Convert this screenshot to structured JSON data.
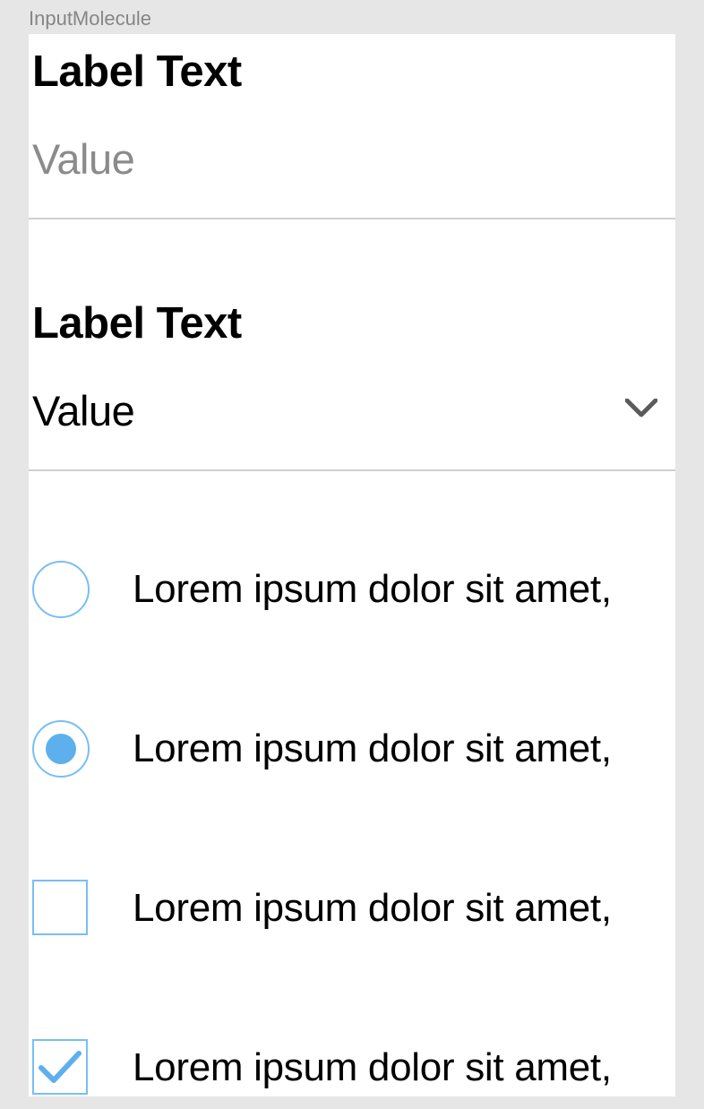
{
  "componentTitle": "InputMolecule",
  "textField": {
    "label": "Label Text",
    "placeholder": "Value"
  },
  "selectField": {
    "label": "Label Text",
    "value": "Value"
  },
  "options": [
    {
      "type": "radio",
      "checked": false,
      "label": "Lorem ipsum dolor sit amet,"
    },
    {
      "type": "radio",
      "checked": true,
      "label": "Lorem ipsum dolor sit amet,"
    },
    {
      "type": "checkbox",
      "checked": false,
      "label": "Lorem ipsum dolor sit amet,"
    },
    {
      "type": "checkbox",
      "checked": true,
      "label": "Lorem ipsum dolor sit amet,"
    }
  ],
  "colors": {
    "accent": "#5eb0ed",
    "accentBorder": "#79bef5",
    "placeholder": "#8b8b8b",
    "muted": "#868686"
  }
}
